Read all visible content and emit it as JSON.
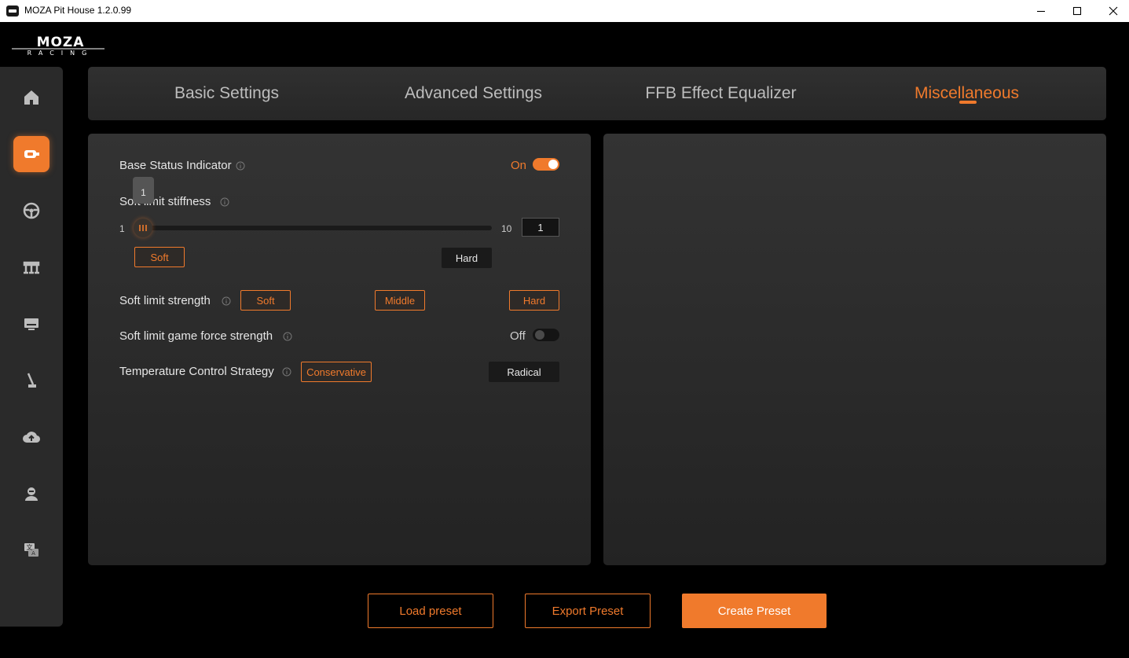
{
  "window": {
    "title": "MOZA Pit House 1.2.0.99"
  },
  "logo": {
    "brand": "MOZA",
    "sub": "RACING"
  },
  "sidebar": {
    "items": [
      {
        "icon": "home-icon",
        "active": false
      },
      {
        "icon": "wheelbase-icon",
        "active": true
      },
      {
        "icon": "steering-wheel-icon",
        "active": false
      },
      {
        "icon": "pedals-icon",
        "active": false
      },
      {
        "icon": "dashboard-icon",
        "active": false
      },
      {
        "icon": "shifter-icon",
        "active": false
      },
      {
        "icon": "cloud-upload-icon",
        "active": false
      },
      {
        "icon": "user-icon",
        "active": false
      },
      {
        "icon": "language-icon",
        "active": false
      }
    ]
  },
  "tabs": [
    {
      "label": "Basic Settings",
      "active": false
    },
    {
      "label": "Advanced Settings",
      "active": false
    },
    {
      "label": "FFB Effect Equalizer",
      "active": false
    },
    {
      "label": "Miscellaneous",
      "active": true
    }
  ],
  "settings": {
    "base_status": {
      "label": "Base Status Indicator",
      "state": "On",
      "enabled": true
    },
    "stiffness": {
      "label": "Soft limit stiffness",
      "min": "1",
      "max": "10",
      "value": "1",
      "tooltip": "1",
      "level_fraction": 0,
      "soft_label": "Soft",
      "hard_label": "Hard"
    },
    "strength": {
      "label": "Soft limit strength",
      "options": [
        "Soft",
        "Middle",
        "Hard"
      ]
    },
    "game_force": {
      "label": "Soft limit game force strength",
      "state": "Off",
      "enabled": false
    },
    "temperature": {
      "label": "Temperature Control Strategy",
      "options": [
        "Conservative",
        "Radical"
      ]
    }
  },
  "buttons": {
    "load": "Load preset",
    "export": "Export Preset",
    "create": "Create Preset"
  },
  "colors": {
    "accent": "#f07a2c",
    "background": "#000000",
    "panel": "#2b2b2b"
  }
}
